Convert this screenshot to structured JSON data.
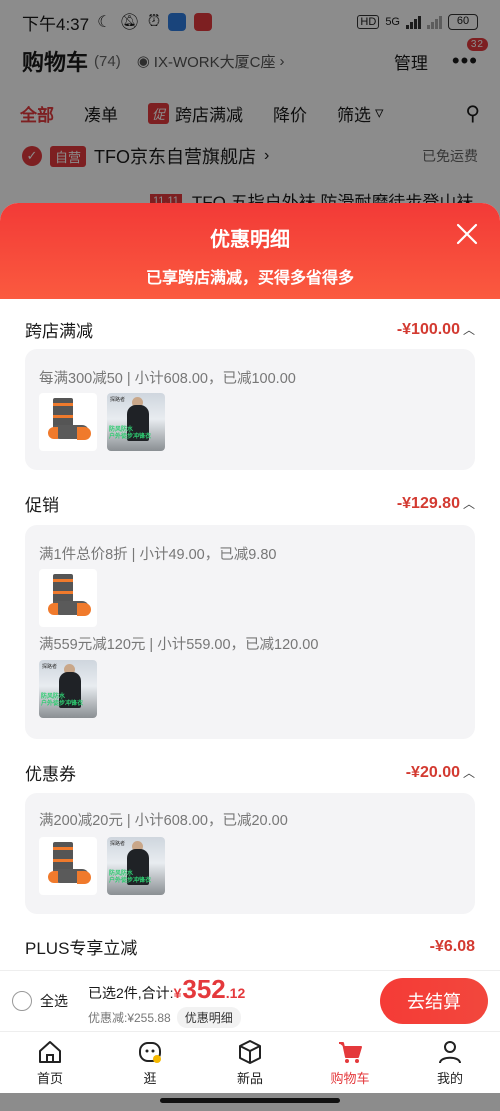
{
  "status_bar": {
    "time": "下午4:37",
    "network": "5G",
    "battery": "60",
    "hd": "HD"
  },
  "header": {
    "title": "购物车",
    "count": "(74)",
    "location": "IX-WORK大厦C座",
    "manage": "管理",
    "more_badge": "32"
  },
  "tabs": [
    {
      "label": "全部"
    },
    {
      "label": "凑单"
    },
    {
      "label": "跨店满减",
      "tag": "促"
    },
    {
      "label": "降价"
    },
    {
      "label": "筛选"
    }
  ],
  "store": {
    "self_tag": "自营",
    "name": "TFO京东自营旗舰店",
    "shipping": "已免运费"
  },
  "product_peek": {
    "tag": "11.11",
    "title": "TFO 五指户外袜 防滑耐磨徒步登山袜"
  },
  "sheet": {
    "title": "优惠明细",
    "subtitle": "已享跨店满减，买得多省得多",
    "sections": [
      {
        "title": "跨店满减",
        "amount": "-¥100.00",
        "rules": [
          "每满300减50 | 小计608.00，已减100.00"
        ]
      },
      {
        "title": "促销",
        "amount": "-¥129.80",
        "rules": [
          "满1件总价8折 | 小计49.00，已减9.80",
          "满559元减120元 | 小计559.00，已减120.00"
        ]
      },
      {
        "title": "优惠券",
        "amount": "-¥20.00",
        "rules": [
          "满200减20元 | 小计608.00，已减20.00"
        ]
      },
      {
        "title": "PLUS专享立减",
        "amount": "-¥6.08"
      }
    ],
    "thumb_labels": {
      "jacket_brand": "探路者",
      "jacket_text_1": "防风防水",
      "jacket_text_2": "户外徒步冲锋衣"
    }
  },
  "checkout": {
    "select_all": "全选",
    "selected_label": "已选2件,合计:",
    "currency": "¥",
    "total_int": "352",
    "total_dec": ".12",
    "discount_label": "优惠减:¥255.88",
    "detail_chip": "优惠明细",
    "button": "去结算"
  },
  "bottom_nav": [
    {
      "label": "首页",
      "icon": "home-icon"
    },
    {
      "label": "逛",
      "icon": "browse-icon"
    },
    {
      "label": "新品",
      "icon": "new-product-icon"
    },
    {
      "label": "购物车",
      "icon": "cart-icon",
      "active": true
    },
    {
      "label": "我的",
      "icon": "profile-icon"
    }
  ],
  "colors": {
    "accent": "#e4393c",
    "header_gradient_top": "#f23a37",
    "amount_red": "#d33a31"
  }
}
